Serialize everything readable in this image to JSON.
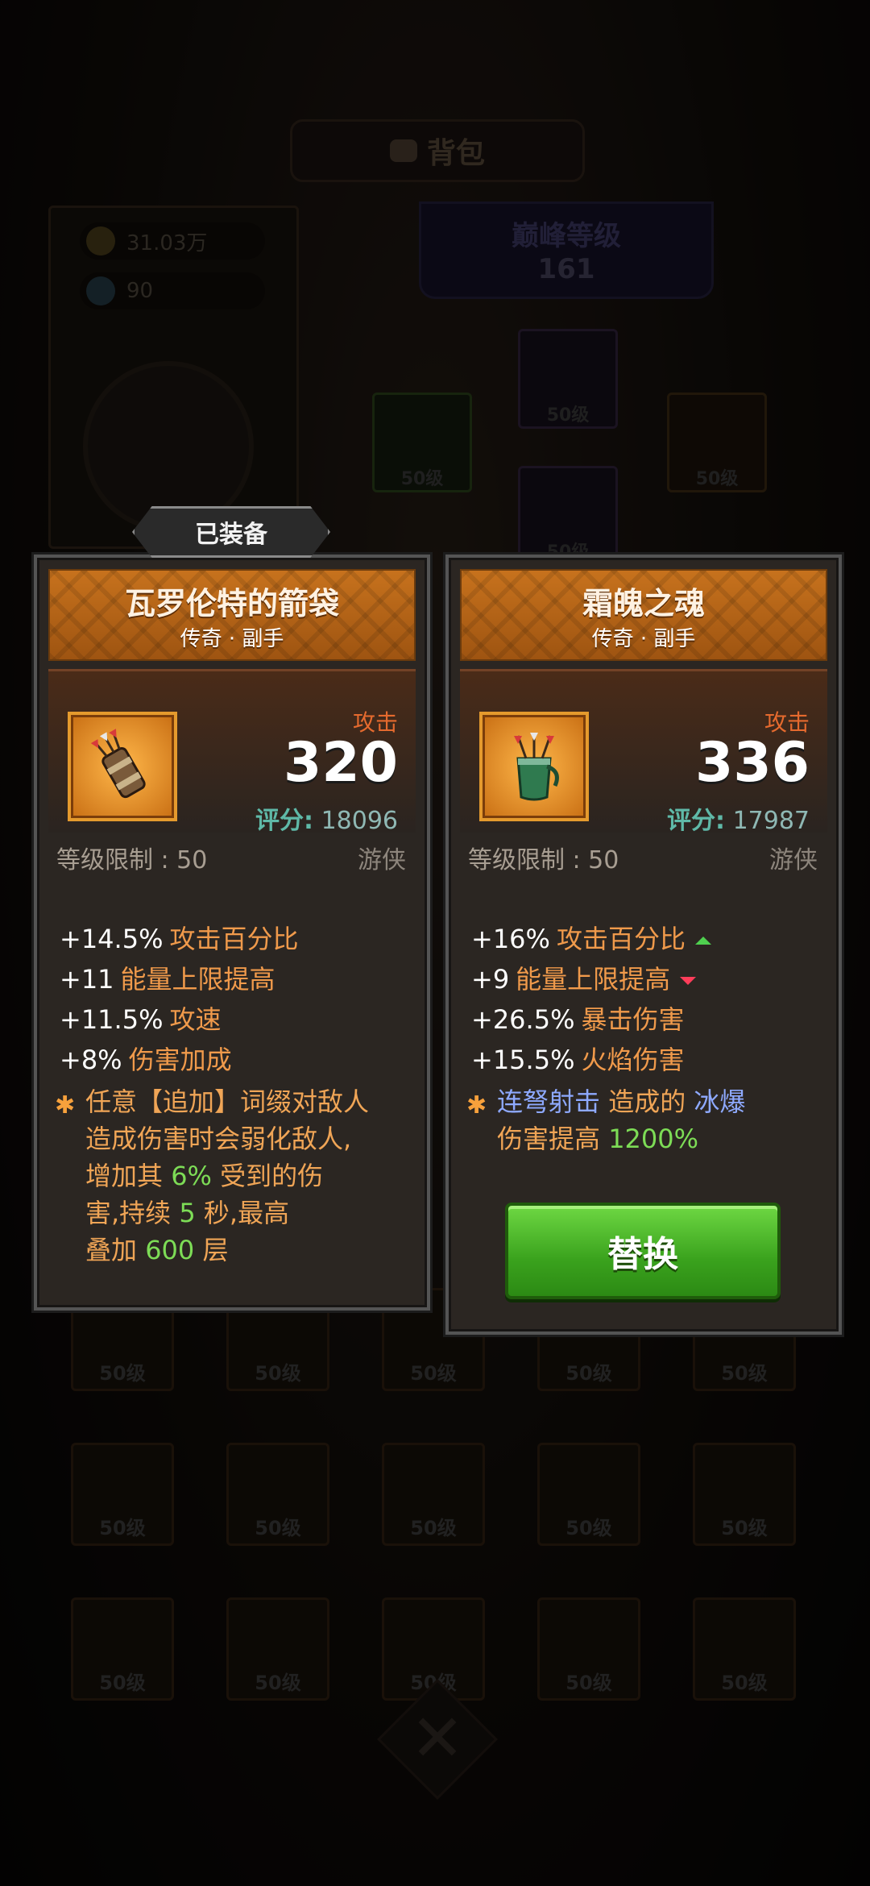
{
  "background": {
    "title": "背包",
    "gold": "31.03万",
    "gems": "90",
    "rank_title": "巅峰等级",
    "rank_value": "161",
    "gear_level": "50级"
  },
  "equipped_badge": "已装备",
  "current_item": {
    "name": "瓦罗伦特的箭袋",
    "subtitle": "传奇 · 副手",
    "attack_label": "攻击",
    "attack_value": "320",
    "score_label": "评分:",
    "score_value": "18096",
    "level_limit": "等级限制 : 50",
    "class": "游侠",
    "attrs": [
      {
        "value": "+14.5%",
        "name": "攻击百分比"
      },
      {
        "value": "+11",
        "name": "能量上限提高"
      },
      {
        "value": "+11.5%",
        "name": "攻速"
      },
      {
        "value": "+8%",
        "name": "伤害加成"
      }
    ],
    "desc_line1": "任意【追加】词缀对敌人",
    "desc_line2": "造成伤害时会弱化敌人,",
    "desc_line3a": "增加其",
    "desc_line3b": "6%",
    "desc_line3c": "受到的伤",
    "desc_line4a": "害,持续",
    "desc_line4b": "5",
    "desc_line4c": "秒,最高",
    "desc_line5a": "叠加",
    "desc_line5b": "600",
    "desc_line5c": "层"
  },
  "new_item": {
    "name": "霜魄之魂",
    "subtitle": "传奇 · 副手",
    "attack_label": "攻击",
    "attack_value": "336",
    "score_label": "评分:",
    "score_value": "17987",
    "level_limit": "等级限制 : 50",
    "class": "游侠",
    "attrs": [
      {
        "value": "+16%",
        "name": "攻击百分比",
        "trend": "up"
      },
      {
        "value": "+9",
        "name": "能量上限提高",
        "trend": "down"
      },
      {
        "value": "+26.5%",
        "name": "暴击伤害"
      },
      {
        "value": "+15.5%",
        "name": "火焰伤害"
      }
    ],
    "desc_a": "连弩射击",
    "desc_b": "造成的",
    "desc_c": "冰爆",
    "desc_d": "伤害提高",
    "desc_e": "1200%",
    "replace_label": "替换"
  }
}
